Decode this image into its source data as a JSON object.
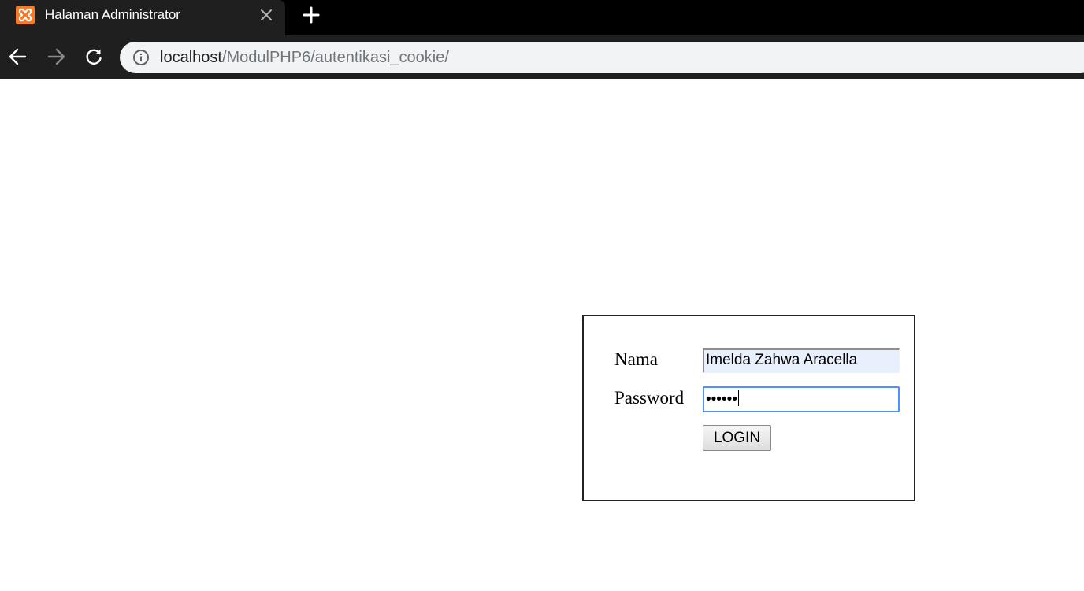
{
  "browser": {
    "tab": {
      "title": "Halaman Administrator",
      "favicon": "xampp-logo-icon"
    },
    "address_bar": {
      "host": "localhost",
      "path": "/ModulPHP6/autentikasi_cookie/"
    },
    "colors": {
      "tabstrip": "#000000",
      "toolbar": "#1f1f1f",
      "omnibox": "#f1f3f4",
      "favicon": "#fb7a24"
    }
  },
  "login_form": {
    "nama_label": "Nama",
    "nama_value": "Imelda Zahwa Aracella",
    "password_label": "Password",
    "password_value": "••••••",
    "login_button": "LOGIN",
    "colors": {
      "autofill_bg": "#e8f0fe",
      "focus_border": "#4d90fe"
    }
  }
}
